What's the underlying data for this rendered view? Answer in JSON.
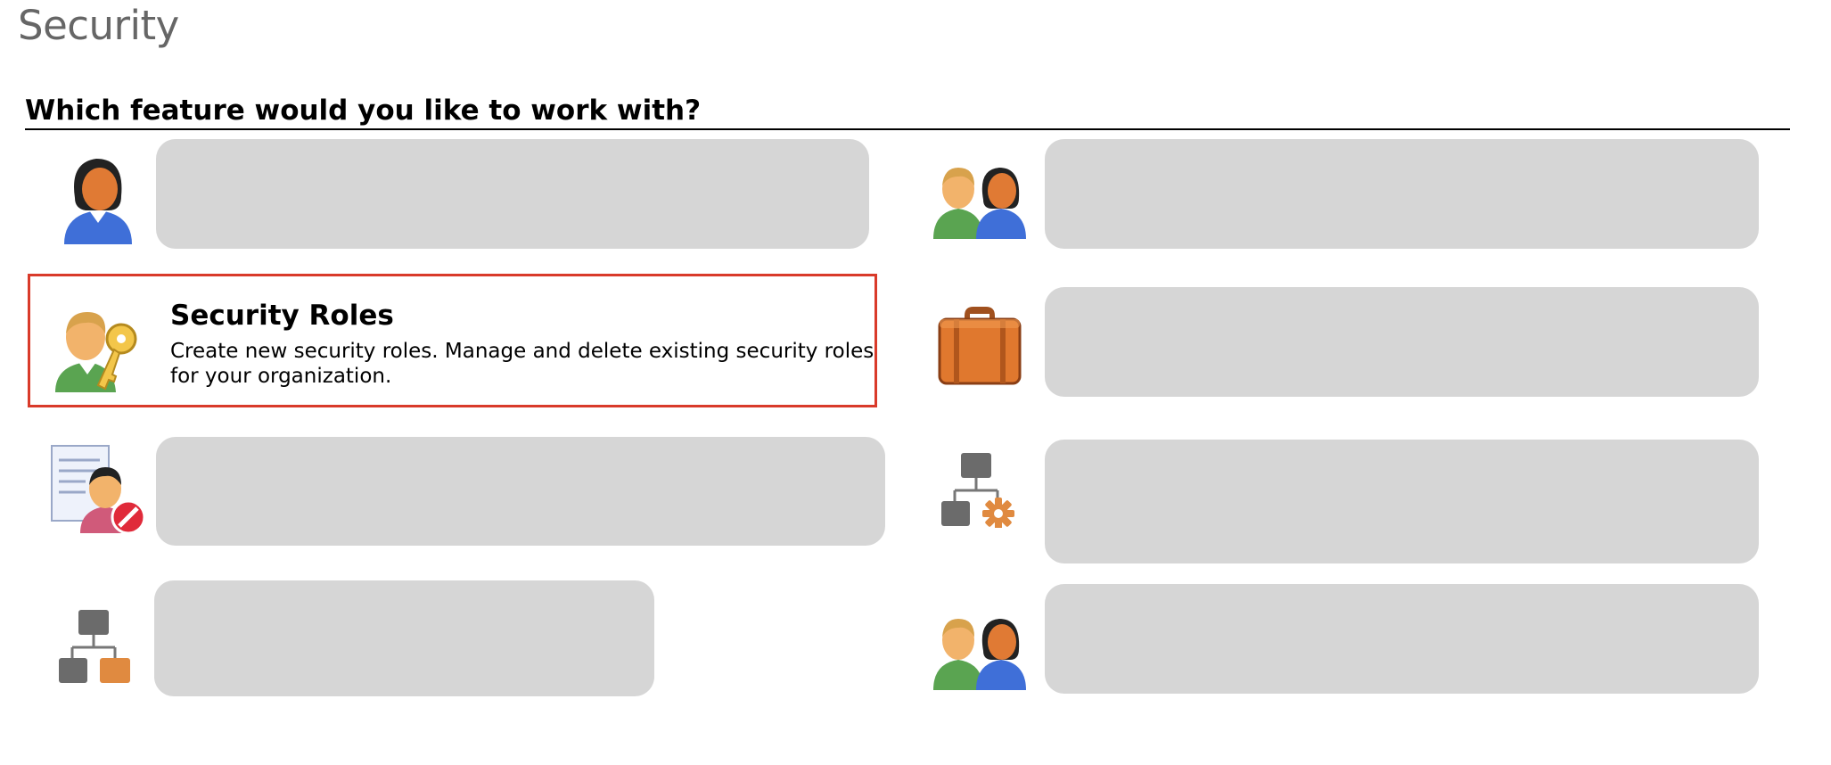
{
  "page": {
    "title": "Security",
    "question": "Which feature would you like to work with?"
  },
  "features": [
    {
      "slot": "left-1",
      "icon": "user-icon",
      "label": ""
    },
    {
      "slot": "left-2",
      "icon": "user-key-icon",
      "label": "Security Roles",
      "description": "Create new security roles. Manage and delete existing security roles for your organization.",
      "selected": true
    },
    {
      "slot": "left-3",
      "icon": "user-blocked-icon",
      "label": ""
    },
    {
      "slot": "left-4",
      "icon": "hierarchy-icon",
      "label": ""
    },
    {
      "slot": "right-1",
      "icon": "users-icon",
      "label": ""
    },
    {
      "slot": "right-2",
      "icon": "briefcase-icon",
      "label": ""
    },
    {
      "slot": "right-3",
      "icon": "hierarchy-settings-icon",
      "label": ""
    },
    {
      "slot": "right-4",
      "icon": "users-icon",
      "label": ""
    }
  ],
  "colors": {
    "selection_border": "#d93a2a",
    "placeholder": "#d6d6d6",
    "title_gray": "#666666"
  }
}
